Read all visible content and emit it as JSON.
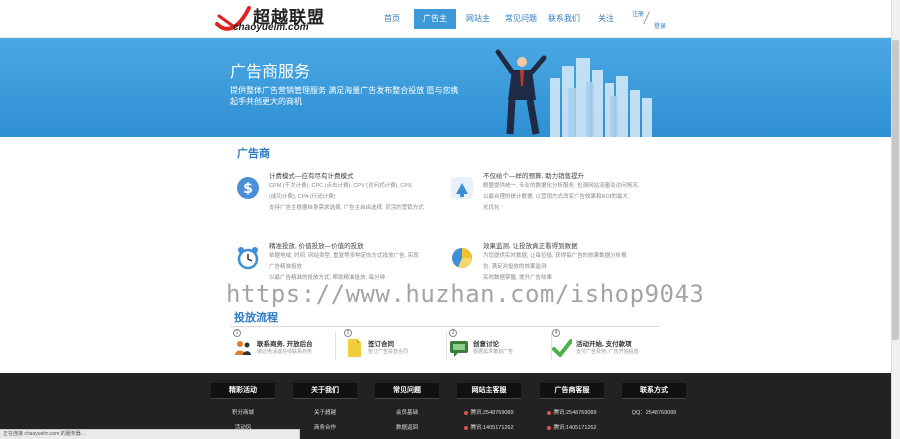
{
  "header": {
    "logo_cn": "超越联盟",
    "logo_en": "chaoyuelm.com",
    "nav": [
      {
        "label": "首页"
      },
      {
        "label": "广告主"
      },
      {
        "label": "网站主"
      },
      {
        "label": "常见问题"
      },
      {
        "label": "联系我们"
      },
      {
        "label": "关注"
      }
    ],
    "active_nav": "广告主",
    "auth_login": "注册",
    "auth_register": "登录"
  },
  "banner": {
    "title": "广告商服务",
    "desc": "提供整体广告营销管理服务 满足海量广告发布整合投放 愿与您携起手共创更大的商机"
  },
  "ad_section": {
    "title": "广告商",
    "features": [
      {
        "icon": "dollar-icon",
        "title": "计费模式—应有尽有计费模式",
        "lines": [
          "CPM (千次计费), CPC (点击计费), CPV (访问式计费), CPS",
          "(成功计费), CPA (行动计费)",
          "支持广告主根据自身需求选择, 广告主自由选择, 灵活的营销方式"
        ]
      },
      {
        "icon": "arrow-up-icon",
        "title": "不仅给个—样的预算, 助力销售提升",
        "lines": [
          "联盟提供统一, 专业的数据化分析服务, 检测网站流量及访问情况,",
          "以最合理的统计数据, 以营销方式改变广告效果和ROI的最大",
          "化优化"
        ]
      },
      {
        "icon": "alarm-clock-icon",
        "title": "精准投放, 价值投放—价值的投放",
        "lines": [
          "依据地域, 时间, 网站类型, 重复等多种定向方式投放广告, 实现",
          "广告精准投放",
          "以最广告精准的投放方式, 帮助精准投放, 每分钟"
        ]
      },
      {
        "icon": "pie-chart-icon",
        "title": "效果监测, 让投放真正看得到数据",
        "lines": [
          "为您提供实时数据, 让每位投, 获得每广告的效果数据分析报",
          "告, 满足对投放的效果监测",
          "实时数据掌握, 提升广告效果"
        ]
      }
    ]
  },
  "flow_section": {
    "title": "投放流程",
    "steps": [
      {
        "num": "1",
        "icon": "people-icon",
        "title": "联系商务, 开放后台",
        "desc": "通过电话或在线联系商务"
      },
      {
        "num": "2",
        "icon": "document-icon",
        "title": "签订合同",
        "desc": "签订广告投放合同"
      },
      {
        "num": "3",
        "icon": "chat-icon",
        "title": "创意讨论",
        "desc": "根据需求策划广告"
      },
      {
        "num": "4",
        "icon": "check-icon",
        "title": "活动开始, 支付款项",
        "desc": "支付广告费用, 广告开始投放"
      }
    ]
  },
  "footer": {
    "columns": [
      {
        "title": "精彩活动",
        "items": [
          "积分商城",
          "活动风"
        ]
      },
      {
        "title": "关于我们",
        "items": [
          "关于超越",
          "商务合作"
        ]
      },
      {
        "title": "常见问题",
        "items": [
          "会员基础",
          "数据返回"
        ]
      },
      {
        "title": "网站主客服",
        "items": [
          "腾讯:2548769089",
          "腾讯:1405171262"
        ],
        "dots": true
      },
      {
        "title": "广告商客服",
        "items": [
          "腾讯:2548769089",
          "腾讯:1405171262"
        ],
        "dots": true
      },
      {
        "title": "联系方式",
        "items": [
          "QQ：2548769089"
        ]
      }
    ]
  },
  "watermark": "https://www.huzhan.com/ishop9043",
  "status_bar": "正在连接 chaoyuelm.com 的服务器..."
}
